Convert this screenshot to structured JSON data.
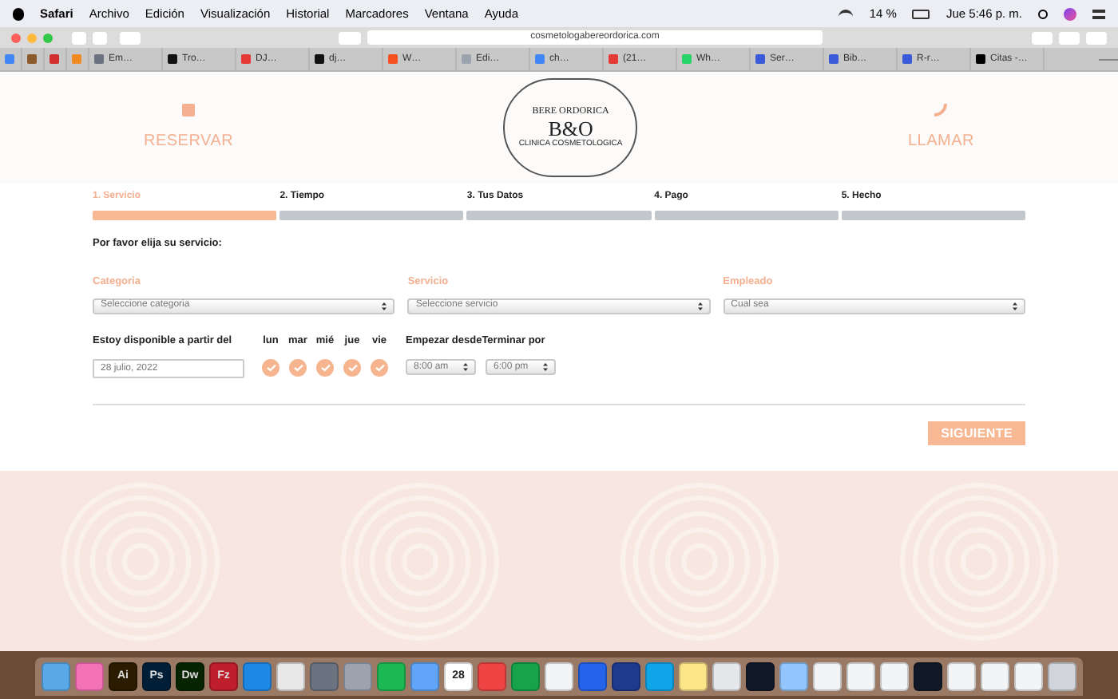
{
  "menubar": {
    "app": "Safari",
    "items": [
      "Archivo",
      "Edición",
      "Visualización",
      "Historial",
      "Marcadores",
      "Ventana",
      "Ayuda"
    ],
    "battery": "14 %",
    "clock": "Jue 5:46 p. m."
  },
  "browser": {
    "url": "cosmetologabereordorica.com",
    "tabs": [
      {
        "color": "#4285f4"
      },
      {
        "color": "#8b5a2b"
      },
      {
        "color": "#d32f2f"
      },
      {
        "color": "#f08a24"
      },
      {
        "label": "Em…",
        "color": "#6b7280"
      },
      {
        "label": "Tro…",
        "color": "#111111"
      },
      {
        "label": "DJ…",
        "color": "#e53935"
      },
      {
        "label": "dj…",
        "color": "#111111"
      },
      {
        "label": "W…",
        "color": "#f4511e"
      },
      {
        "label": "Edi…",
        "color": "#9ca3af"
      },
      {
        "label": "ch…",
        "color": "#4285f4"
      },
      {
        "label": "(21…",
        "color": "#e53935"
      },
      {
        "label": "Wh…",
        "color": "#25d366"
      },
      {
        "label": "Ser…",
        "color": "#3b5bdb"
      },
      {
        "label": "Bib…",
        "color": "#3b5bdb"
      },
      {
        "label": "R-r…",
        "color": "#3b5bdb"
      },
      {
        "label": "Citas -…",
        "color": "#000000"
      }
    ]
  },
  "header": {
    "left": "RESERVAR",
    "right": "LLAMAR",
    "logo": {
      "top": "BERE ORDORICA",
      "monogram": "B&O",
      "bottom": "CLINICA COSMETOLOGICA"
    }
  },
  "steps": [
    {
      "label": "1. Servicio",
      "selected": true
    },
    {
      "label": "2. Tiempo",
      "selected": false
    },
    {
      "label": "3. Tus Datos",
      "selected": false
    },
    {
      "label": "4. Pago",
      "selected": false
    },
    {
      "label": "5. Hecho",
      "selected": false
    }
  ],
  "prompt": "Por favor elija su servicio:",
  "selects": [
    {
      "label": "Categoria",
      "value": "Seleccione categoria"
    },
    {
      "label": "Servicio",
      "value": "Seleccione servicio"
    },
    {
      "label": "Empleado",
      "value": "Cual sea"
    }
  ],
  "availability": {
    "label": "Estoy disponible a partir del",
    "date": "28 julio, 2022",
    "days": [
      {
        "label": "lun",
        "checked": true
      },
      {
        "label": "mar",
        "checked": true
      },
      {
        "label": "mié",
        "checked": true
      },
      {
        "label": "jue",
        "checked": true
      },
      {
        "label": "vie",
        "checked": true
      }
    ],
    "start_label": "Empezar desde",
    "start": "8:00 am",
    "end_label": "Terminar por",
    "end": "6:00 pm"
  },
  "next_button": "SIGUIENTE",
  "dock": [
    {
      "color": "#5aa9e6"
    },
    {
      "color": "#f472b6"
    },
    {
      "label": "Ai",
      "color": "#2b1b00"
    },
    {
      "label": "Ps",
      "color": "#001e36"
    },
    {
      "label": "Dw",
      "color": "#072401"
    },
    {
      "label": "Fz",
      "color": "#bf1e2d"
    },
    {
      "color": "#1e88e5"
    },
    {
      "color": "#e8e8e8"
    },
    {
      "color": "#6b7280"
    },
    {
      "color": "#9ca3af"
    },
    {
      "color": "#1db954"
    },
    {
      "color": "#60a5fa"
    },
    {
      "label": "28",
      "color": "#ffffff"
    },
    {
      "color": "#ef4444"
    },
    {
      "color": "#16a34a"
    },
    {
      "color": "#f3f4f6"
    },
    {
      "color": "#2563eb"
    },
    {
      "color": "#1e3a8a"
    },
    {
      "color": "#0ea5e9"
    },
    {
      "color": "#fde68a"
    },
    {
      "color": "#e5e7eb"
    },
    {
      "color": "#111827"
    },
    {
      "color": "#93c5fd"
    },
    {
      "color": "#f3f4f6"
    },
    {
      "color": "#f3f4f6"
    },
    {
      "color": "#f3f4f6"
    },
    {
      "color": "#111827"
    },
    {
      "color": "#f3f4f6"
    },
    {
      "color": "#f3f4f6"
    },
    {
      "color": "#f3f4f6"
    },
    {
      "color": "#d1d5db"
    }
  ]
}
